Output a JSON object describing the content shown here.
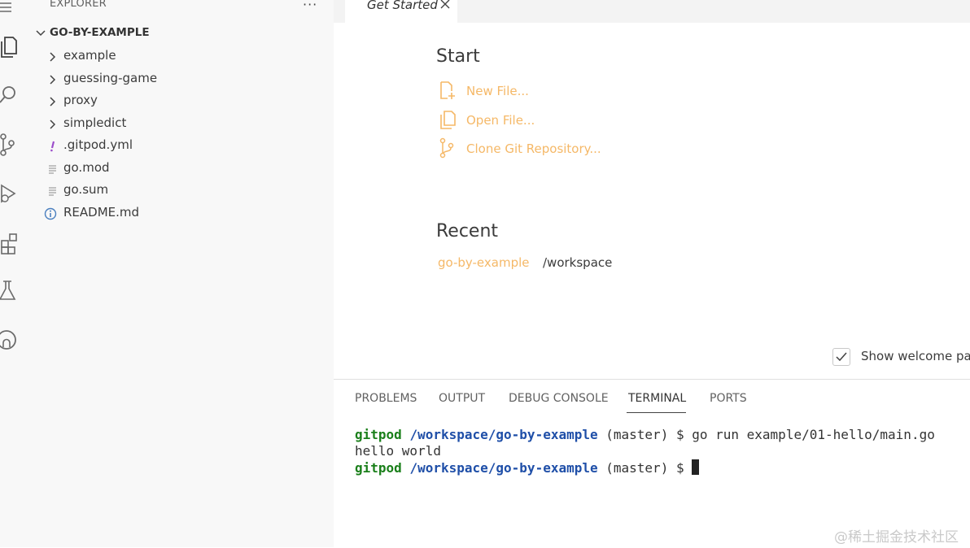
{
  "explorer": {
    "header": "EXPLORER",
    "more": "···",
    "workspace": "GO-BY-EXAMPLE",
    "items": [
      {
        "label": "example",
        "type": "folder"
      },
      {
        "label": "guessing-game",
        "type": "folder"
      },
      {
        "label": "proxy",
        "type": "folder"
      },
      {
        "label": "simpledict",
        "type": "folder"
      },
      {
        "label": ".gitpod.yml",
        "type": "yaml"
      },
      {
        "label": "go.mod",
        "type": "file"
      },
      {
        "label": "go.sum",
        "type": "file"
      },
      {
        "label": "README.md",
        "type": "info"
      }
    ]
  },
  "activity_bar": [
    "files-icon",
    "search-icon",
    "source-control-icon",
    "run-debug-icon",
    "extensions-icon",
    "testing-icon",
    "github-icon"
  ],
  "editor": {
    "tab": {
      "label": "Get Started",
      "close": "✕"
    },
    "welcome": {
      "start_title": "Start",
      "start_items": [
        {
          "label": "New File...",
          "icon": "new-file-icon"
        },
        {
          "label": "Open File...",
          "icon": "open-file-icon"
        },
        {
          "label": "Clone Git Repository...",
          "icon": "git-branch-icon"
        }
      ],
      "recent_title": "Recent",
      "recent": [
        {
          "name": "go-by-example",
          "path": "/workspace"
        }
      ],
      "show_welcome_label": "Show welcome pag",
      "show_welcome_checked": true
    }
  },
  "panel": {
    "tabs": [
      "PROBLEMS",
      "OUTPUT",
      "DEBUG CONSOLE",
      "TERMINAL",
      "PORTS"
    ],
    "active_tab": "TERMINAL",
    "terminal": [
      {
        "user": "gitpod",
        "path": "/workspace/go-by-example",
        "rest": " (master) $ go run example/01-hello/main.go"
      },
      {
        "output": "hello world"
      },
      {
        "user": "gitpod",
        "path": "/workspace/go-by-example",
        "rest": " (master) $ "
      }
    ]
  },
  "watermark": "@稀土掘金技术社区",
  "colors": {
    "link": "#f5b867",
    "sidebar_bg": "#f8f8f8",
    "terminal_user": "#1a7f1a",
    "terminal_path": "#1f4fa8"
  }
}
